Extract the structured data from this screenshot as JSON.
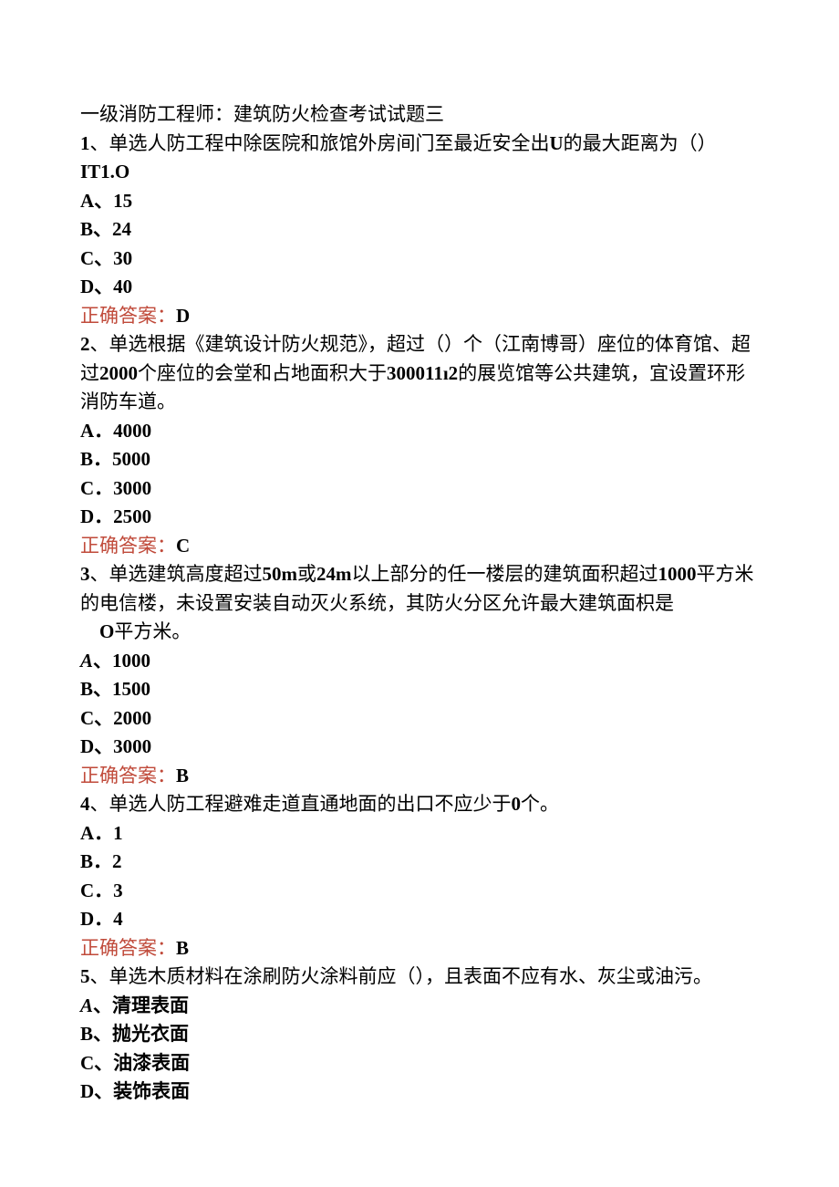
{
  "title": "一级消防工程师：建筑防火检查考试试题三",
  "q1": {
    "stem_a": "1",
    "stem_b": "、单选人防工程中除医院和旅馆外房间门至最近安全出",
    "stem_c": "U",
    "stem_d": "的最大距离为（）",
    "unit": "IT1.O",
    "opts": {
      "a": "A、15",
      "b": "B、24",
      "c": "C、30",
      "d": "D、40"
    },
    "ans_label": "正确答案：",
    "ans_val": "D"
  },
  "q2": {
    "stem_a": "2",
    "stem_b": "、单选根据《建筑设计防火规范》，超过（）个（江南博哥）座位的体育馆、超过",
    "stem_c": "2000",
    "stem_d": "个座位的会堂和占地面积大于",
    "stem_e": "300011ı2",
    "stem_f": "的展览馆等公共建筑，宜设置环形消防车道。",
    "opts": {
      "a": "A．4000",
      "b": "B．5000",
      "c": "C．3000",
      "d": "D．2500"
    },
    "ans_label": "正确答案：",
    "ans_val": "C"
  },
  "q3": {
    "stem_a": "3",
    "stem_b": "、单选建筑高度超过",
    "stem_c": "50m",
    "stem_d": "或",
    "stem_e": "24m",
    "stem_f": "以上部分的任一楼层的建筑面积超过",
    "stem_g": "1000",
    "stem_h": "平方米的电信楼，未设置安装自动灭火系统，其防火分区允许最大建筑面枳是",
    "stem_i": "　O",
    "stem_j": "平方米。",
    "opts": {
      "a_prefix": "A",
      "a_mid": "、",
      "a_val": "1000",
      "b": "B、1500",
      "c": "C、2000",
      "d": "D、3000"
    },
    "ans_label": "正确答案：",
    "ans_val": "B"
  },
  "q4": {
    "stem_a": "4",
    "stem_b": "、单选人防工程避难走道直通地面的出口不应少于",
    "stem_c": "0",
    "stem_d": "个。",
    "opts": {
      "a": "A．1",
      "b": "B．2",
      "c": "C．3",
      "d": "D．4"
    },
    "ans_label": "正确答案：",
    "ans_val": "B"
  },
  "q5": {
    "stem_a": "5",
    "stem_b": "、单选木质材料在涂刷防火涂料前应（），且表面不应有水、灰尘或油污。",
    "opts": {
      "a_prefix": "A",
      "a_mid": "、清理表面",
      "b": "B、抛光衣面",
      "c": "C、油漆表面",
      "d": "D、装饰表面"
    }
  }
}
